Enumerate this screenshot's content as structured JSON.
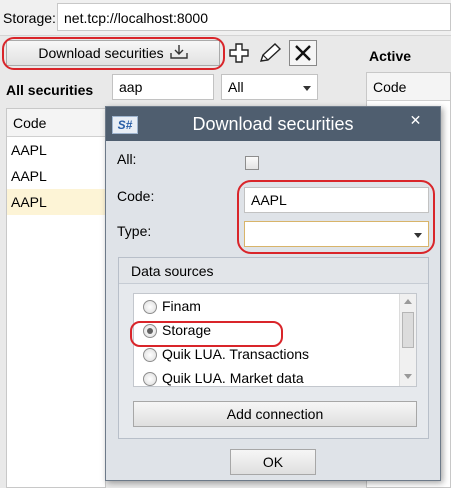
{
  "storage": {
    "label": "Storage:",
    "value": "net.tcp://localhost:8000"
  },
  "toolbar": {
    "download_label": "Download securities",
    "icons": [
      "download-icon",
      "add-icon",
      "edit-icon",
      "delete-icon"
    ]
  },
  "all_securities": {
    "title": "All securities",
    "filter_value": "aap",
    "type_filter": "All",
    "grid": {
      "column": "Code",
      "rows": [
        {
          "code": "AAPL"
        },
        {
          "code": "AAPL"
        },
        {
          "code": "AAPL"
        }
      ]
    }
  },
  "active": {
    "title": "Active",
    "grid": {
      "column": "Code"
    }
  },
  "dialog": {
    "logo": "S#",
    "title": "Download securities",
    "close": "✕",
    "all_label": "All:",
    "code_label": "Code:",
    "code_value": "AAPL",
    "type_label": "Type:",
    "type_value": "",
    "data_sources": {
      "title": "Data sources",
      "items": [
        {
          "label": "Finam",
          "selected": false
        },
        {
          "label": "Storage",
          "selected": true
        },
        {
          "label": "Quik LUA. Transactions",
          "selected": false
        },
        {
          "label": "Quik LUA. Market data",
          "selected": false
        }
      ],
      "add_connection": "Add connection"
    },
    "ok": "OK"
  },
  "colors": {
    "highlight": "#d9252a",
    "title_bar": "#4f5e6f",
    "selected_row": "#fdf4d6"
  }
}
